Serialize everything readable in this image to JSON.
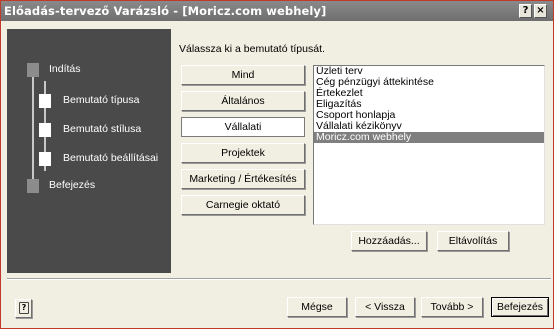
{
  "window": {
    "title": "Előadás-tervező Varázsló - [Moricz.com webhely]",
    "help_glyph": "?",
    "close_glyph": "×"
  },
  "steps": [
    {
      "label": "Indítás"
    },
    {
      "label": "Bemutató típusa"
    },
    {
      "label": "Bemutató stílusa"
    },
    {
      "label": "Bemutató beállításai"
    },
    {
      "label": "Befejezés"
    }
  ],
  "main": {
    "instruction": "Válassza ki a bemutató típusát.",
    "categories": [
      {
        "label": "Mind"
      },
      {
        "label": "Általános"
      },
      {
        "label": "Vállalati"
      },
      {
        "label": "Projektek"
      },
      {
        "label": "Marketing / Értékesítés"
      },
      {
        "label": "Carnegie oktató"
      }
    ],
    "active_category": "Vállalati",
    "list_items": [
      {
        "label": "Üzleti terv"
      },
      {
        "label": "Cég pénzügyi áttekintése"
      },
      {
        "label": "Értekezlet"
      },
      {
        "label": "Eligazítás"
      },
      {
        "label": "Csoport honlapja"
      },
      {
        "label": "Vállalati kézikönyv"
      },
      {
        "label": "Moricz.com webhely"
      }
    ],
    "selected_item": "Moricz.com webhely",
    "add_button": "Hozzáadás...",
    "remove_button": "Eltávolítás"
  },
  "footer": {
    "cancel": "Mégse",
    "back": "< Vissza",
    "next": "Tovább >",
    "finish": "Befejezés",
    "help_icon": "help-icon"
  }
}
